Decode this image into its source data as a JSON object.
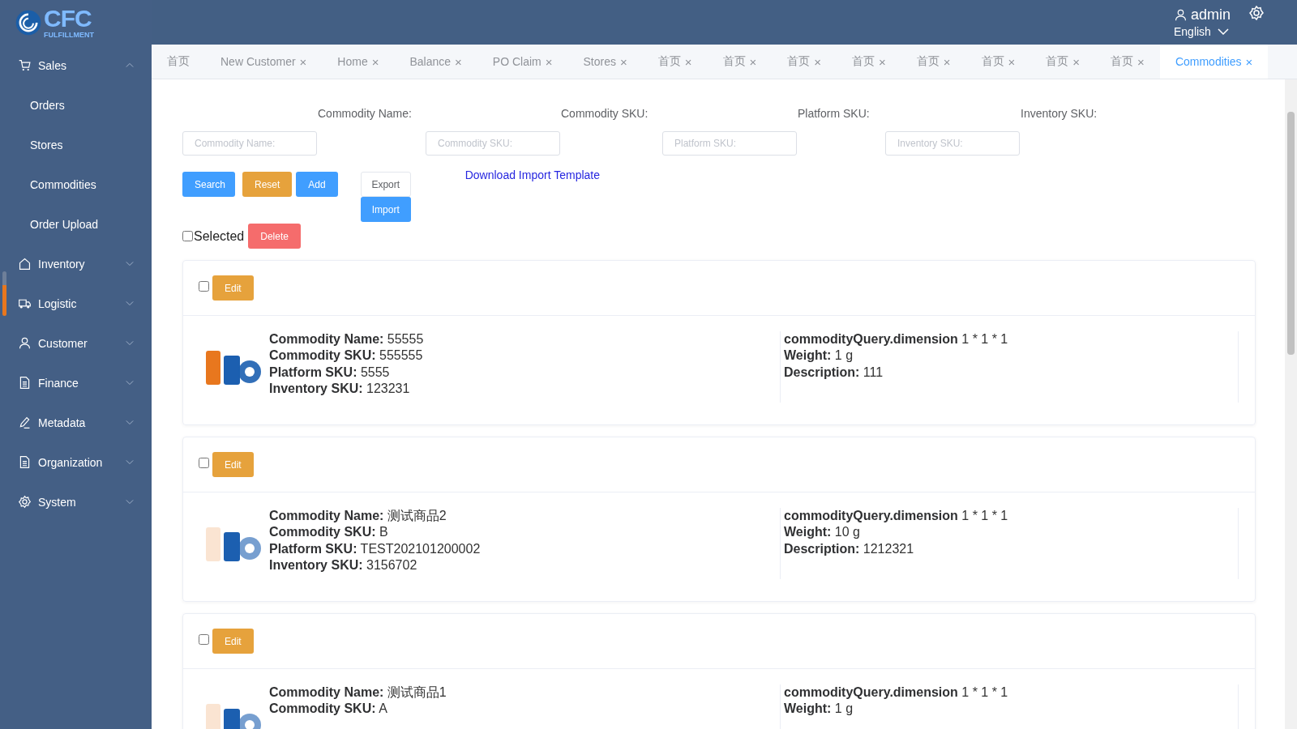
{
  "logo": {
    "name": "CFC",
    "tagline": "FULFILLMENT"
  },
  "header": {
    "user": "admin",
    "language": "English"
  },
  "sidebar": {
    "items": [
      {
        "label": "Sales",
        "expanded": true,
        "children": [
          {
            "label": "Orders"
          },
          {
            "label": "Stores"
          },
          {
            "label": "Commodities"
          },
          {
            "label": "Order Upload"
          }
        ]
      },
      {
        "label": "Inventory",
        "expanded": false
      },
      {
        "label": "Logistic",
        "expanded": false
      },
      {
        "label": "Customer",
        "expanded": false
      },
      {
        "label": "Finance",
        "expanded": false
      },
      {
        "label": "Metadata",
        "expanded": false
      },
      {
        "label": "Organization",
        "expanded": false
      },
      {
        "label": "System",
        "expanded": false
      }
    ]
  },
  "tabs": [
    {
      "label": "首页",
      "closable": false,
      "selected": false
    },
    {
      "label": "New Customer",
      "closable": true,
      "selected": false
    },
    {
      "label": "Home",
      "closable": true,
      "selected": false
    },
    {
      "label": "Balance",
      "closable": true,
      "selected": false
    },
    {
      "label": "PO Claim",
      "closable": true,
      "selected": false
    },
    {
      "label": "Stores",
      "closable": true,
      "selected": false
    },
    {
      "label": "首页",
      "closable": true,
      "selected": false
    },
    {
      "label": "首页",
      "closable": true,
      "selected": false
    },
    {
      "label": "首页",
      "closable": true,
      "selected": false
    },
    {
      "label": "首页",
      "closable": true,
      "selected": false
    },
    {
      "label": "首页",
      "closable": true,
      "selected": false
    },
    {
      "label": "首页",
      "closable": true,
      "selected": false
    },
    {
      "label": "首页",
      "closable": true,
      "selected": false
    },
    {
      "label": "首页",
      "closable": true,
      "selected": false
    },
    {
      "label": "Commodities",
      "closable": true,
      "selected": true
    }
  ],
  "close_glyph": "×",
  "filters": [
    {
      "label": "Commodity Name:",
      "placeholder": "Commodity Name:"
    },
    {
      "label": "Commodity SKU:",
      "placeholder": "Commodity SKU:"
    },
    {
      "label": "Platform SKU:",
      "placeholder": "Platform SKU:"
    },
    {
      "label": "Inventory SKU:",
      "placeholder": "Inventory SKU:"
    }
  ],
  "actions": {
    "search": "Search",
    "reset": "Reset",
    "add": "Add",
    "export": "Export",
    "import": "Import",
    "template_link": "Download Import Template"
  },
  "selection": {
    "label": "Selected",
    "checked": false,
    "delete": "Delete"
  },
  "commodities": [
    {
      "checked": false,
      "edit": "Edit",
      "picture": {
        "kind": "picture"
      },
      "left": [
        {
          "label": "Commodity Name:",
          "value": "55555"
        },
        {
          "label": "Commodity SKU:",
          "value": "555555"
        },
        {
          "label": "Platform SKU:",
          "value": "5555"
        },
        {
          "label": "Inventory SKU:",
          "value": "123231"
        }
      ],
      "right": [
        {
          "label": "commodityQuery.dimension",
          "value": "1 * 1 * 1"
        },
        {
          "label": "Weight:",
          "value": "1 g"
        },
        {
          "label": "Description:",
          "value": "111"
        }
      ]
    },
    {
      "checked": false,
      "edit": "Edit",
      "picture": {
        "kind": "picture"
      },
      "left": [
        {
          "label": "Commodity Name:",
          "value": "测试商品2"
        },
        {
          "label": "Commodity SKU:",
          "value": "B"
        },
        {
          "label": "Platform SKU:",
          "value": "TEST202101200002"
        },
        {
          "label": "Inventory SKU:",
          "value": "3156702"
        }
      ],
      "right": [
        {
          "label": "commodityQuery.dimension",
          "value": "1 * 1 * 1"
        },
        {
          "label": "Weight:",
          "value": "10 g"
        },
        {
          "label": "Description:",
          "value": "1212321"
        }
      ]
    },
    {
      "checked": false,
      "edit": "Edit",
      "picture": {
        "kind": "picture"
      },
      "left": [
        {
          "label": "Commodity Name:",
          "value": "测试商品1"
        },
        {
          "label": "Commodity SKU:",
          "value": "A"
        }
      ],
      "right": [
        {
          "label": "commodityQuery.dimension",
          "value": "1 * 1 * 1"
        },
        {
          "label": "Weight:",
          "value": "1 g"
        }
      ]
    }
  ]
}
